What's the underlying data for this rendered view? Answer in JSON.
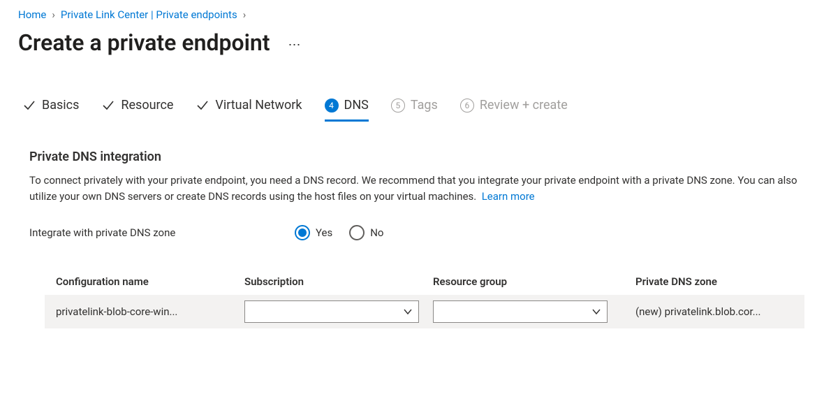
{
  "breadcrumb": {
    "home": "Home",
    "center": "Private Link Center | Private endpoints"
  },
  "title": "Create a private endpoint",
  "tabs": {
    "basics": "Basics",
    "resource": "Resource",
    "vnet": "Virtual Network",
    "dns_num": "4",
    "dns": "DNS",
    "tags_num": "5",
    "tags": "Tags",
    "review_num": "6",
    "review": "Review + create"
  },
  "section": {
    "heading": "Private DNS integration",
    "description": "To connect privately with your private endpoint, you need a DNS record. We recommend that you integrate your private endpoint with a private DNS zone. You can also utilize your own DNS servers or create DNS records using the host files on your virtual machines.",
    "learn_more": "Learn more"
  },
  "form": {
    "integrate_label": "Integrate with private DNS zone",
    "yes": "Yes",
    "no": "No"
  },
  "table": {
    "headers": {
      "config": "Configuration name",
      "sub": "Subscription",
      "rg": "Resource group",
      "zone": "Private DNS zone"
    },
    "row": {
      "config": "privatelink-blob-core-win...",
      "sub": "",
      "rg": "",
      "zone": "(new) privatelink.blob.cor..."
    }
  }
}
